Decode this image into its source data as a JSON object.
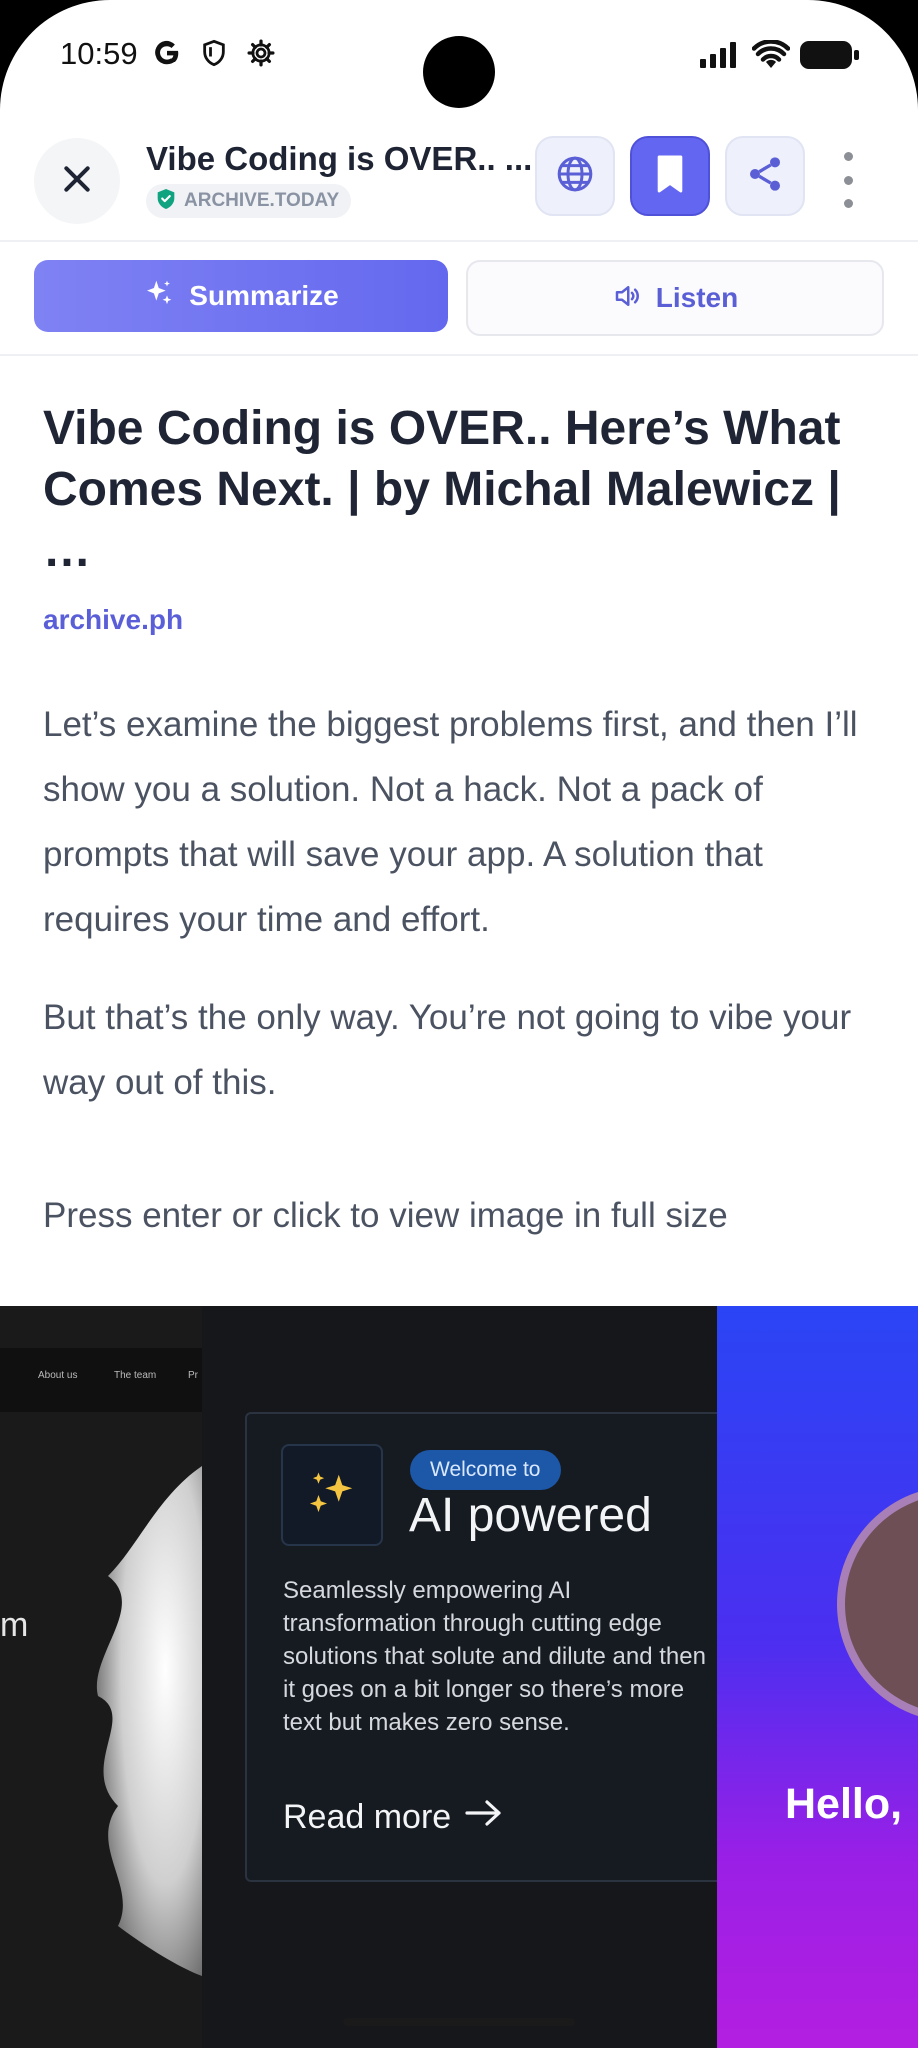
{
  "status_bar": {
    "time": "10:59",
    "icons": [
      "google-icon",
      "shield-icon",
      "gear-icon",
      "signal-icon",
      "wifi-icon",
      "battery-icon"
    ]
  },
  "toolbar": {
    "title": "Vibe Coding is OVER.. ...",
    "source": "ARCHIVE.TODAY",
    "icons": [
      "close-icon",
      "verified-shield-icon",
      "globe-icon",
      "bookmark-icon",
      "share-icon",
      "more-vertical-icon"
    ]
  },
  "actions": {
    "summarize_label": "Summarize",
    "listen_label": "Listen"
  },
  "article": {
    "headline": "Vibe Coding is OVER.. Here’s What Comes Next. | by Michal Malewicz | …",
    "domain": "archive.ph",
    "paragraph_1": "Let’s examine the biggest problems first, and then I’ll show you a solution. Not a hack. Not a pack of prompts that will save your app. A solution that requires your time and effort.",
    "paragraph_2": "But that’s the only way. You’re not going to vibe your way out of this.",
    "image_hint": "Press enter or click to view image in full size"
  },
  "image": {
    "nav_items": [
      "About us",
      "The team",
      "Pr"
    ],
    "left_fragment": "m",
    "welcome": "Welcome to",
    "title": "AI powered",
    "body": "Seamlessly empowering AI transformation through cutting edge solutions that solute and dilute and then it goes on a bit longer so there’s more text but makes zero sense.",
    "read_more": "Read more",
    "hello": "Hello,",
    "accent_blue": "#2a45f5",
    "accent_purple": "#b31fe0"
  },
  "colors": {
    "primary": "#6366f1",
    "link": "#5a5fd8",
    "headline": "#1f2535",
    "body_text": "#4b5362"
  }
}
